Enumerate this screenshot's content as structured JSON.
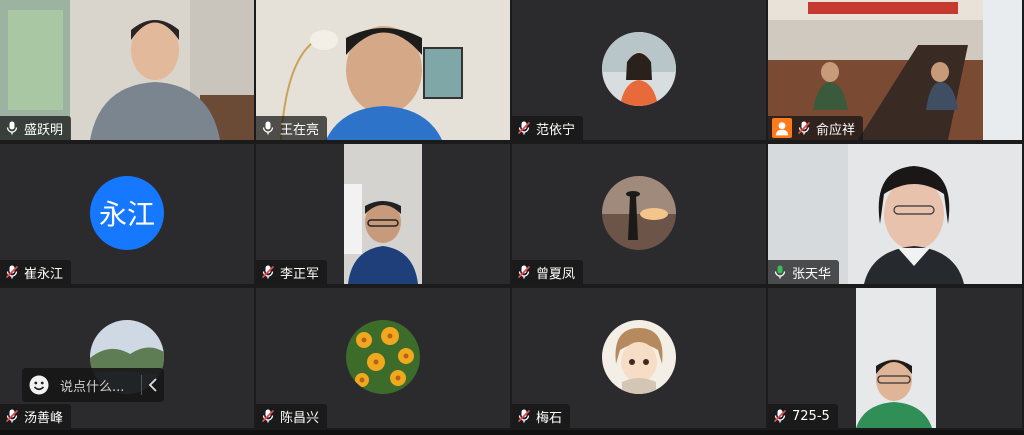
{
  "participants": [
    {
      "name": "盛跃明",
      "mic": "on"
    },
    {
      "name": "王在亮",
      "mic": "on"
    },
    {
      "name": "范依宁",
      "mic": "muted"
    },
    {
      "name": "俞应祥",
      "mic": "muted",
      "host": true
    },
    {
      "name": "崔永江",
      "mic": "muted",
      "avatar_text": "永江"
    },
    {
      "name": "李正军",
      "mic": "muted"
    },
    {
      "name": "曾夏凤",
      "mic": "muted"
    },
    {
      "name": "张天华",
      "mic": "on",
      "speaking": true
    },
    {
      "name": "汤善峰",
      "mic": "muted"
    },
    {
      "name": "陈昌兴",
      "mic": "muted"
    },
    {
      "name": "梅石",
      "mic": "muted"
    },
    {
      "name": "725-5",
      "mic": "muted"
    }
  ],
  "chat": {
    "placeholder": "说点什么..."
  },
  "colors": {
    "speaking_border": "#35c05a",
    "avatar_blue": "#1677ff",
    "host_badge": "#ff7a1a",
    "muted_red": "#e5484d"
  }
}
